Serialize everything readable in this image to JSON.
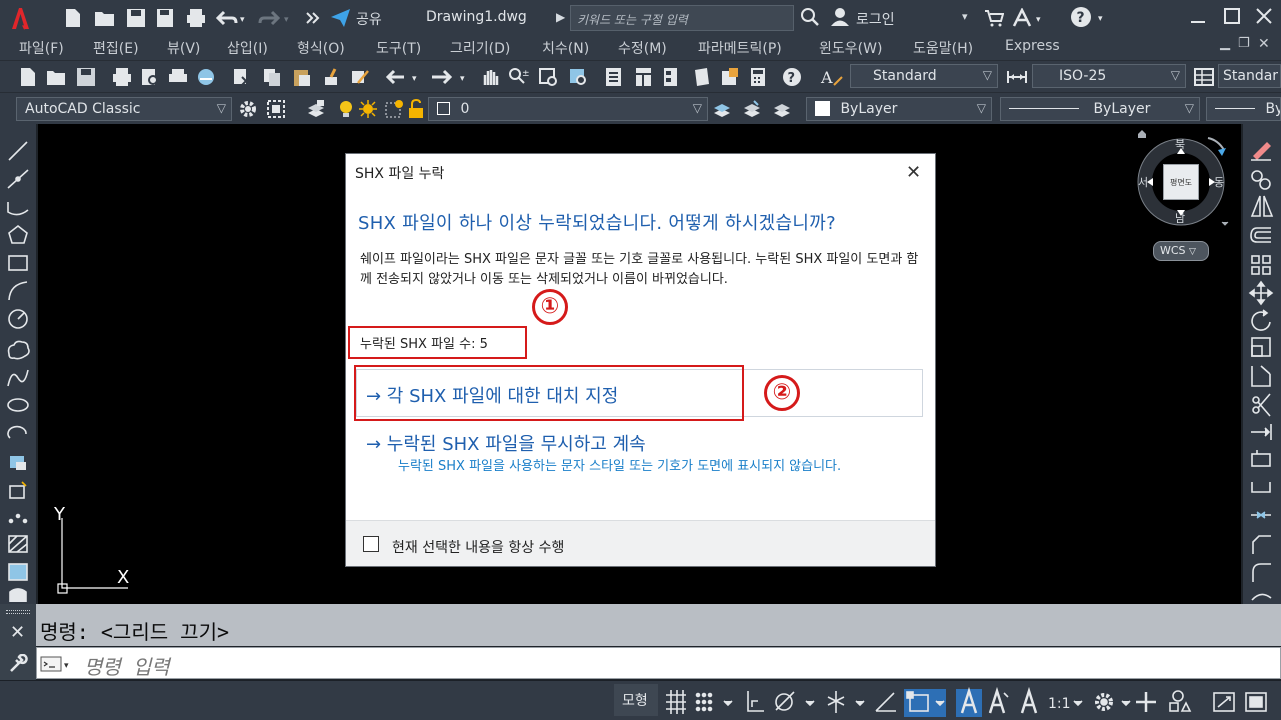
{
  "titlebar": {
    "share": "공유",
    "title": "Drawing1.dwg",
    "search_placeholder": "키워드 또는 구절 입력",
    "login": "로그인"
  },
  "menu": [
    "파일(F)",
    "편집(E)",
    "뷰(V)",
    "삽입(I)",
    "형식(O)",
    "도구(T)",
    "그리기(D)",
    "치수(N)",
    "수정(M)",
    "파라메트릭(P)",
    "윈도우(W)",
    "도움말(H)",
    "Express"
  ],
  "toolbar1": {
    "text_style": "Standard",
    "dim_style": "ISO-25",
    "table_style": "Standar"
  },
  "toolbar2": {
    "workspace": "AutoCAD Classic",
    "layer": "0",
    "color": "ByLayer",
    "linetype": "ByLayer",
    "lineweight": "By"
  },
  "viewcube": {
    "north": "북",
    "south": "남",
    "east": "동",
    "west": "서",
    "face": "평면도",
    "wcs": "WCS"
  },
  "ucs": {
    "y": "Y",
    "x": "X"
  },
  "command": {
    "history": "명령:  <그리드 끄기>",
    "placeholder": "명령 입력"
  },
  "statusbar": {
    "model": "모형",
    "scale": "1:1"
  },
  "dialog": {
    "title": "SHX 파일 누락",
    "heading": "SHX 파일이 하나 이상 누락되었습니다. 어떻게 하시겠습니까?",
    "description": "쉐이프 파일이라는 SHX 파일은 문자 글꼴 또는 기호 글꼴로 사용됩니다. 누락된 SHX 파일이 도면과 함께 전송되지 않았거나 이동 또는 삭제되었거나 이름이 바뀌었습니다.",
    "missing_count": "누락된 SHX 파일 수: 5",
    "option1": "→ 각 SHX 파일에 대한 대치 지정",
    "option2": "→ 누락된 SHX 파일을 무시하고 계속",
    "option2_desc": "누락된 SHX 파일을 사용하는 문자 스타일 또는 기호가 도면에 표시되지 않습니다.",
    "always_label": "현재 선택한 내용을 항상 수행",
    "annotation1": "①",
    "annotation2": "②"
  },
  "colors": {
    "ui_dark": "#323a45",
    "accent_blue": "#1f5fae",
    "annotation_red": "#d51a1a",
    "app_red": "#e0262b"
  }
}
